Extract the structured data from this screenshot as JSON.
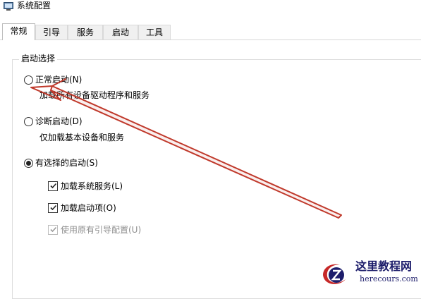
{
  "window": {
    "title": "系统配置",
    "icon": "msconfig-app-icon"
  },
  "tabs": [
    {
      "label": "常规",
      "active": true
    },
    {
      "label": "引导",
      "active": false
    },
    {
      "label": "服务",
      "active": false
    },
    {
      "label": "启动",
      "active": false
    },
    {
      "label": "工具",
      "active": false
    }
  ],
  "startup_selection": {
    "group_title": "启动选择",
    "normal": {
      "label": "正常启动(N)",
      "description": "加载所有设备驱动程序和服务",
      "selected": false
    },
    "diagnostic": {
      "label": "诊断启动(D)",
      "description": "仅加载基本设备和服务",
      "selected": false
    },
    "selective": {
      "label": "有选择的启动(S)",
      "selected": true,
      "options": [
        {
          "label": "加载系统服务(L)",
          "checked": true,
          "enabled": true
        },
        {
          "label": "加载启动项(O)",
          "checked": true,
          "enabled": true
        },
        {
          "label": "使用原有引导配置(U)",
          "checked": true,
          "enabled": false
        }
      ]
    }
  },
  "annotation": {
    "type": "red-double-arrow",
    "color": "#c0392b",
    "points_to": "normal-startup-radio"
  },
  "watermark": {
    "title": "这里教程网",
    "url": "herecours.com",
    "logo_color": "#c62828",
    "text_color": "#1d1d6b"
  }
}
